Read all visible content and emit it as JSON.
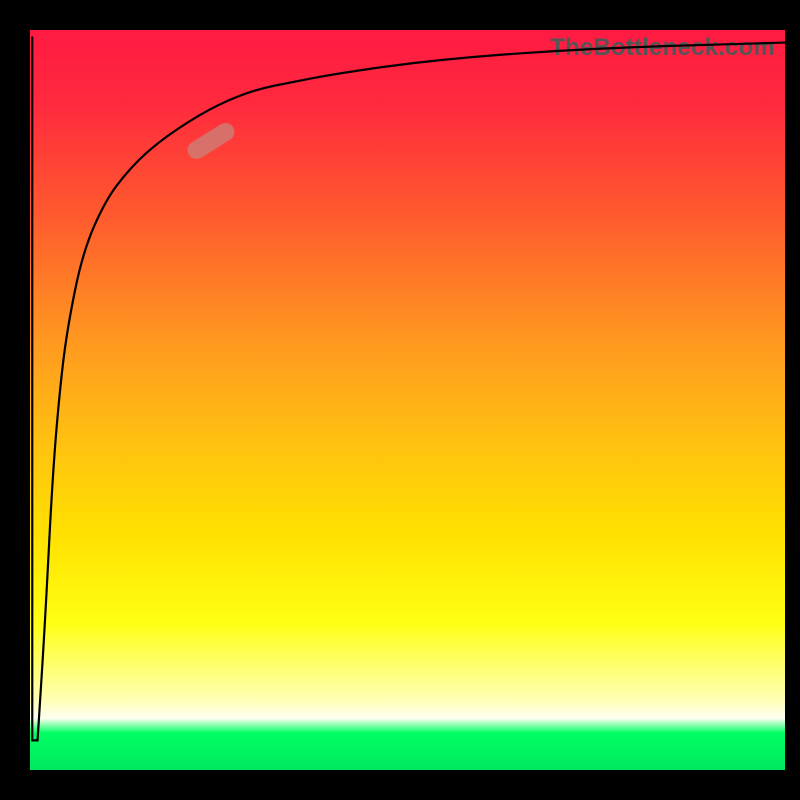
{
  "attribution": "TheBottleneck.com",
  "colors": {
    "frame": "#000000",
    "gradient_top": "#ff1a42",
    "gradient_mid": "#ffe000",
    "gradient_band": "#ffffe0",
    "gradient_bottom": "#00e860",
    "curve": "#000000",
    "marker": "#c9837b"
  },
  "chart_data": {
    "type": "line",
    "title": "",
    "xlabel": "",
    "ylabel": "",
    "xlim": [
      0,
      100
    ],
    "ylim": [
      0,
      100
    ],
    "grid": false,
    "legend": false,
    "annotations": [
      {
        "kind": "pill-marker",
        "x": 24,
        "y": 85,
        "angle_deg": -32
      }
    ],
    "series": [
      {
        "name": "saturating-curve",
        "x": [
          0,
          1,
          2,
          3,
          4,
          5,
          7,
          10,
          13,
          16,
          20,
          25,
          30,
          35,
          40,
          50,
          60,
          70,
          80,
          90,
          100
        ],
        "y": [
          99,
          4,
          20,
          40,
          52,
          60,
          70,
          77,
          81,
          84,
          87,
          90,
          92,
          93,
          94,
          95.5,
          96.5,
          97.2,
          97.7,
          98,
          98.3
        ]
      },
      {
        "name": "left-edge-vertical",
        "x": [
          0.3,
          0.3
        ],
        "y": [
          99,
          4
        ]
      }
    ]
  }
}
